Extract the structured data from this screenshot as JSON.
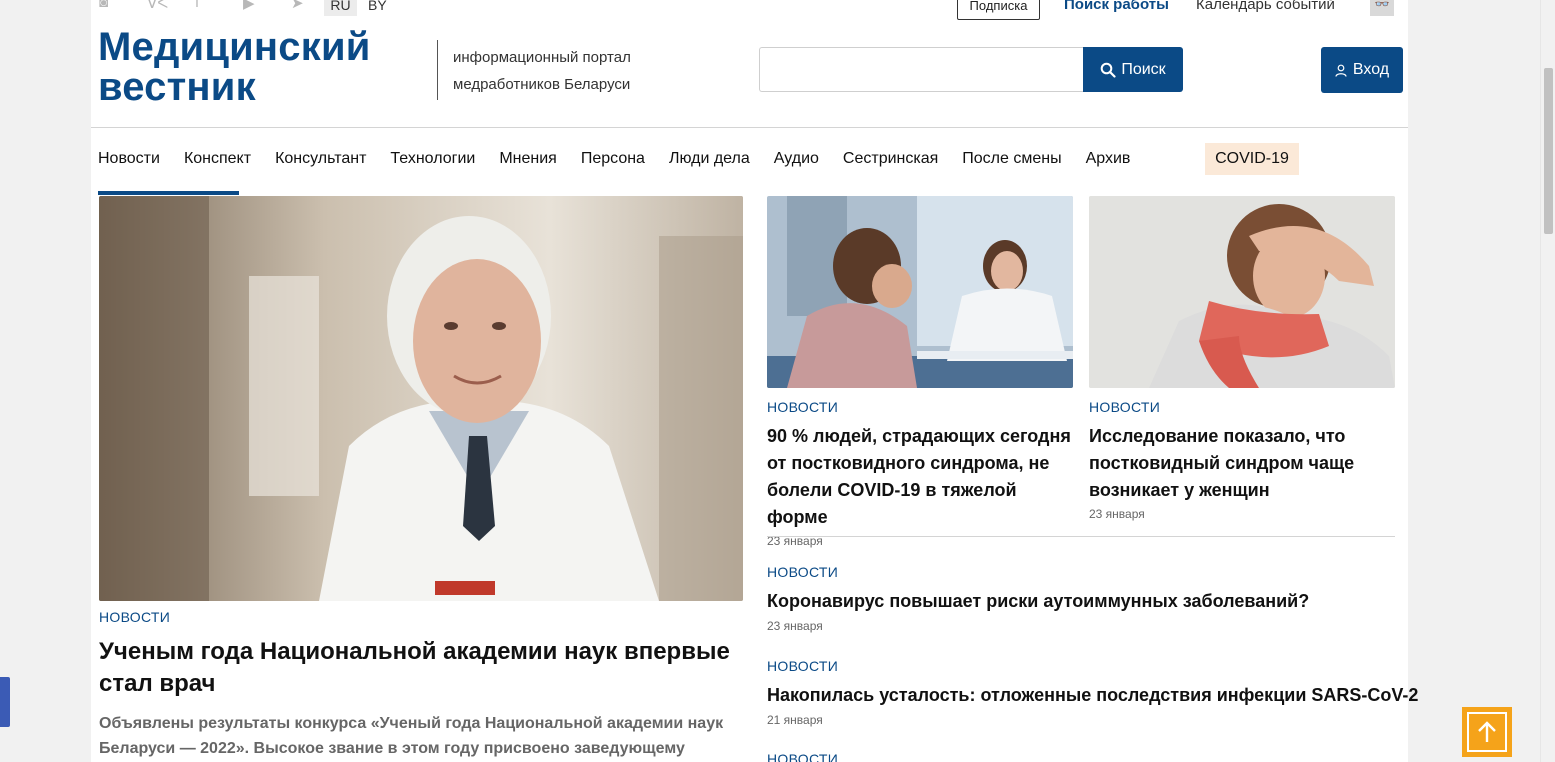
{
  "topbar": {
    "social_icons": [
      "instagram-icon",
      "vk-icon",
      "facebook-icon",
      "youtube-icon",
      "telegram-icon"
    ],
    "social_glyphs": [
      "◙",
      "ᐯᐸ",
      "f",
      "▶",
      "➤"
    ],
    "lang_ru": "RU",
    "lang_by": "BY",
    "subscribe": "Подписка",
    "jobs": "Поиск работы",
    "calendar": "Календарь событий",
    "accessibility_glyph": "👓"
  },
  "header": {
    "logo": "Медицинский вестник",
    "tagline": "информационный портал медработников Беларуси",
    "search_placeholder": "",
    "search_button": "Поиск",
    "login_button": "Вход"
  },
  "nav": {
    "items": [
      "Новости",
      "Конспект",
      "Консультант",
      "Технологии",
      "Мнения",
      "Персона",
      "Люди дела",
      "Аудио",
      "Сестринская",
      "После смены",
      "Архив"
    ],
    "covid": "COVID-19"
  },
  "feature": {
    "category": "НОВОСТИ",
    "title": "Ученым года Национальной академии наук впервые стал врач",
    "lead": "Объявлены результаты конкурса «Ученый года Национальной академии наук Беларуси — 2022». Высокое звание в этом году присвоено заведующему кафедрой"
  },
  "cards": [
    {
      "category": "НОВОСТИ",
      "title": "90 % людей, страдающих сегодня от постковидного синдрома, не болели COVID-19 в тяжелой форме",
      "date": "23 января"
    },
    {
      "category": "НОВОСТИ",
      "title": "Исследование показало, что постковидный синдром чаще возникает у женщин",
      "date": "23 января"
    }
  ],
  "list": [
    {
      "category": "НОВОСТИ",
      "title": "Коронавирус повышает риски аутоиммунных заболеваний?",
      "date": "23 января"
    },
    {
      "category": "НОВОСТИ",
      "title": "Накопилась усталость: отложенные последствия инфекции SARS-CoV-2",
      "date": "21 января"
    },
    {
      "category": "НОВОСТИ"
    }
  ],
  "colors": {
    "brand": "#0b4a86",
    "covid_bg": "#fbe9d8",
    "scroll_top": "#f5a31a"
  }
}
